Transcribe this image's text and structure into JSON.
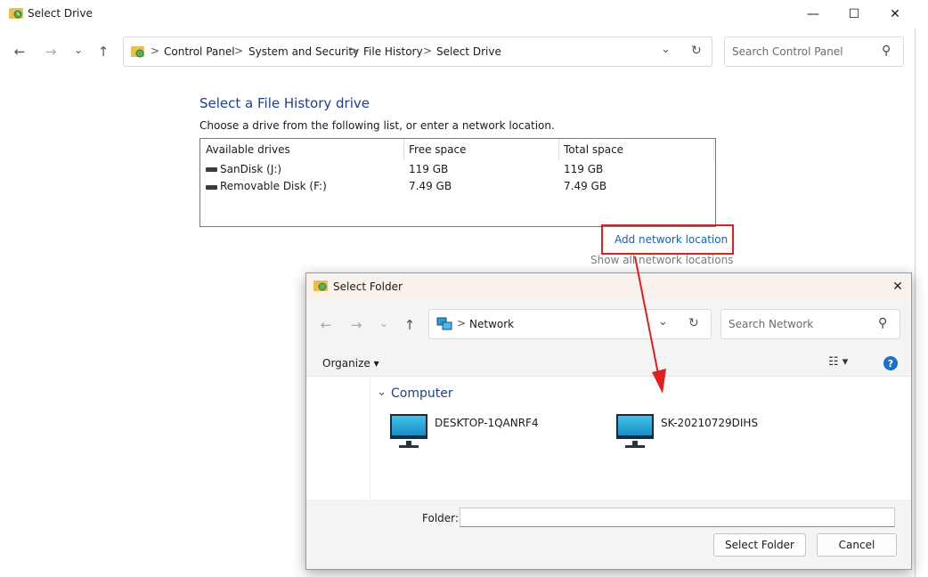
{
  "window": {
    "title": "Select Drive",
    "minimize_glyph": "—",
    "maximize_glyph": "☐",
    "close_glyph": "✕"
  },
  "nav": {
    "back_glyph": "←",
    "forward_glyph": "→",
    "recent_glyph": "⌄",
    "up_glyph": "↑"
  },
  "address": {
    "breadcrumbs": [
      "Control Panel",
      "System and Security",
      "File History",
      "Select Drive"
    ],
    "separator": ">",
    "dropdown_glyph": "⌄",
    "refresh_glyph": "↻"
  },
  "search": {
    "placeholder": "Search Control Panel",
    "icon_glyph": "⚲"
  },
  "page": {
    "heading": "Select a File History drive",
    "subtext": "Choose a drive from the following list, or enter a network location."
  },
  "drives": {
    "columns": [
      "Available drives",
      "Free space",
      "Total space"
    ],
    "rows": [
      {
        "name": "SanDisk (J:)",
        "free": "119 GB",
        "total": "119 GB"
      },
      {
        "name": "Removable Disk (F:)",
        "free": "7.49 GB",
        "total": "7.49 GB"
      }
    ]
  },
  "links": {
    "add_network": "Add network location",
    "show_all": "Show all network locations"
  },
  "annotation": {
    "highlight_color": "#e0201e",
    "arrow_color": "#e0201e"
  },
  "dialog": {
    "title": "Select Folder",
    "close_glyph": "✕",
    "address_label": "Network",
    "search_placeholder": "Search Network",
    "organize_label": "Organize ▾",
    "view_glyph": "☷ ▾",
    "help_glyph": "?",
    "group_header": "Computer",
    "group_chevron": "⌄",
    "computers": [
      "DESKTOP-1QANRF4",
      "SK-20210729DIHS"
    ],
    "folder_label": "Folder:",
    "folder_value": "",
    "select_button": "Select Folder",
    "cancel_button": "Cancel"
  }
}
